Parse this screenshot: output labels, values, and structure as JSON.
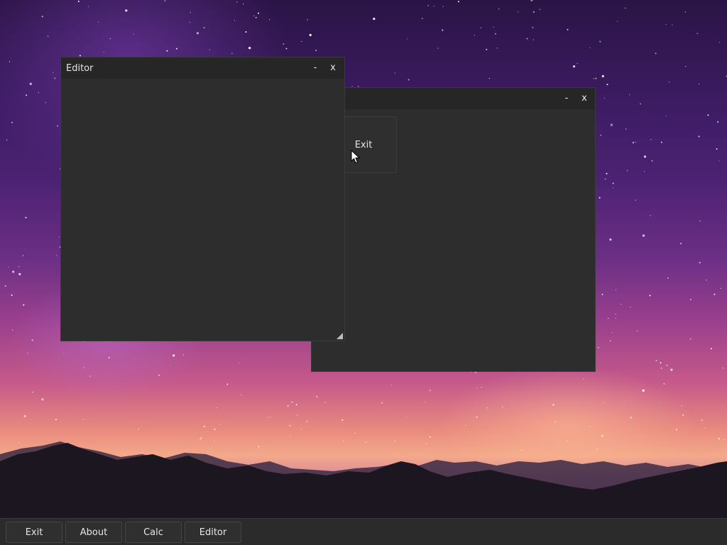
{
  "theme": {
    "window_bg": "#2d2d2d",
    "titlebar_bg": "#262626",
    "text_color": "#e6e6e6",
    "taskbar_bg": "#2b2b2b"
  },
  "windows": {
    "background_window": {
      "title": "",
      "minimize_label": "-",
      "close_label": "x",
      "content_button_label": "Exit"
    },
    "editor": {
      "title": "Editor",
      "minimize_label": "-",
      "close_label": "x",
      "resize_grip_icon": "resize-grip-icon"
    }
  },
  "cursor": {
    "icon": "mouse-pointer-icon"
  },
  "taskbar": {
    "buttons": [
      {
        "label": "Exit"
      },
      {
        "label": "About"
      },
      {
        "label": "Calc"
      },
      {
        "label": "Editor"
      }
    ]
  }
}
